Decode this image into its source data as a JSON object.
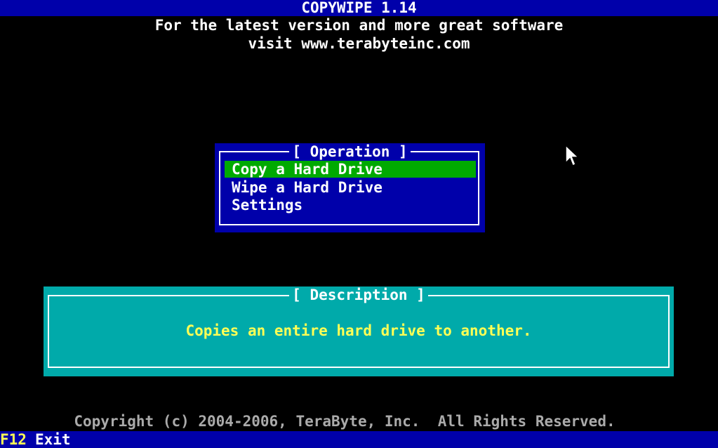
{
  "app": {
    "title": "COPYWIPE 1.14",
    "header_line1": "For the latest version and more great software",
    "header_line2": "visit www.terabyteinc.com"
  },
  "operation": {
    "title": "[ Operation ]",
    "items": [
      {
        "label": "Copy a Hard Drive",
        "selected": true
      },
      {
        "label": "Wipe a Hard Drive",
        "selected": false
      },
      {
        "label": "Settings",
        "selected": false
      }
    ]
  },
  "description": {
    "title": "[ Description ]",
    "text": "Copies an entire hard drive to another."
  },
  "footer": {
    "copyright": "Copyright (c) 2004-2006, TeraByte, Inc.  All Rights Reserved.",
    "key": "F12",
    "key_label": "Exit"
  },
  "colors": {
    "background": "#000000",
    "bar_blue": "#0000aa",
    "selection_green": "#00aa00",
    "description_cyan": "#00aaaa",
    "highlight_yellow": "#ffff55"
  },
  "icons": {
    "cursor": "mouse-pointer-icon"
  }
}
